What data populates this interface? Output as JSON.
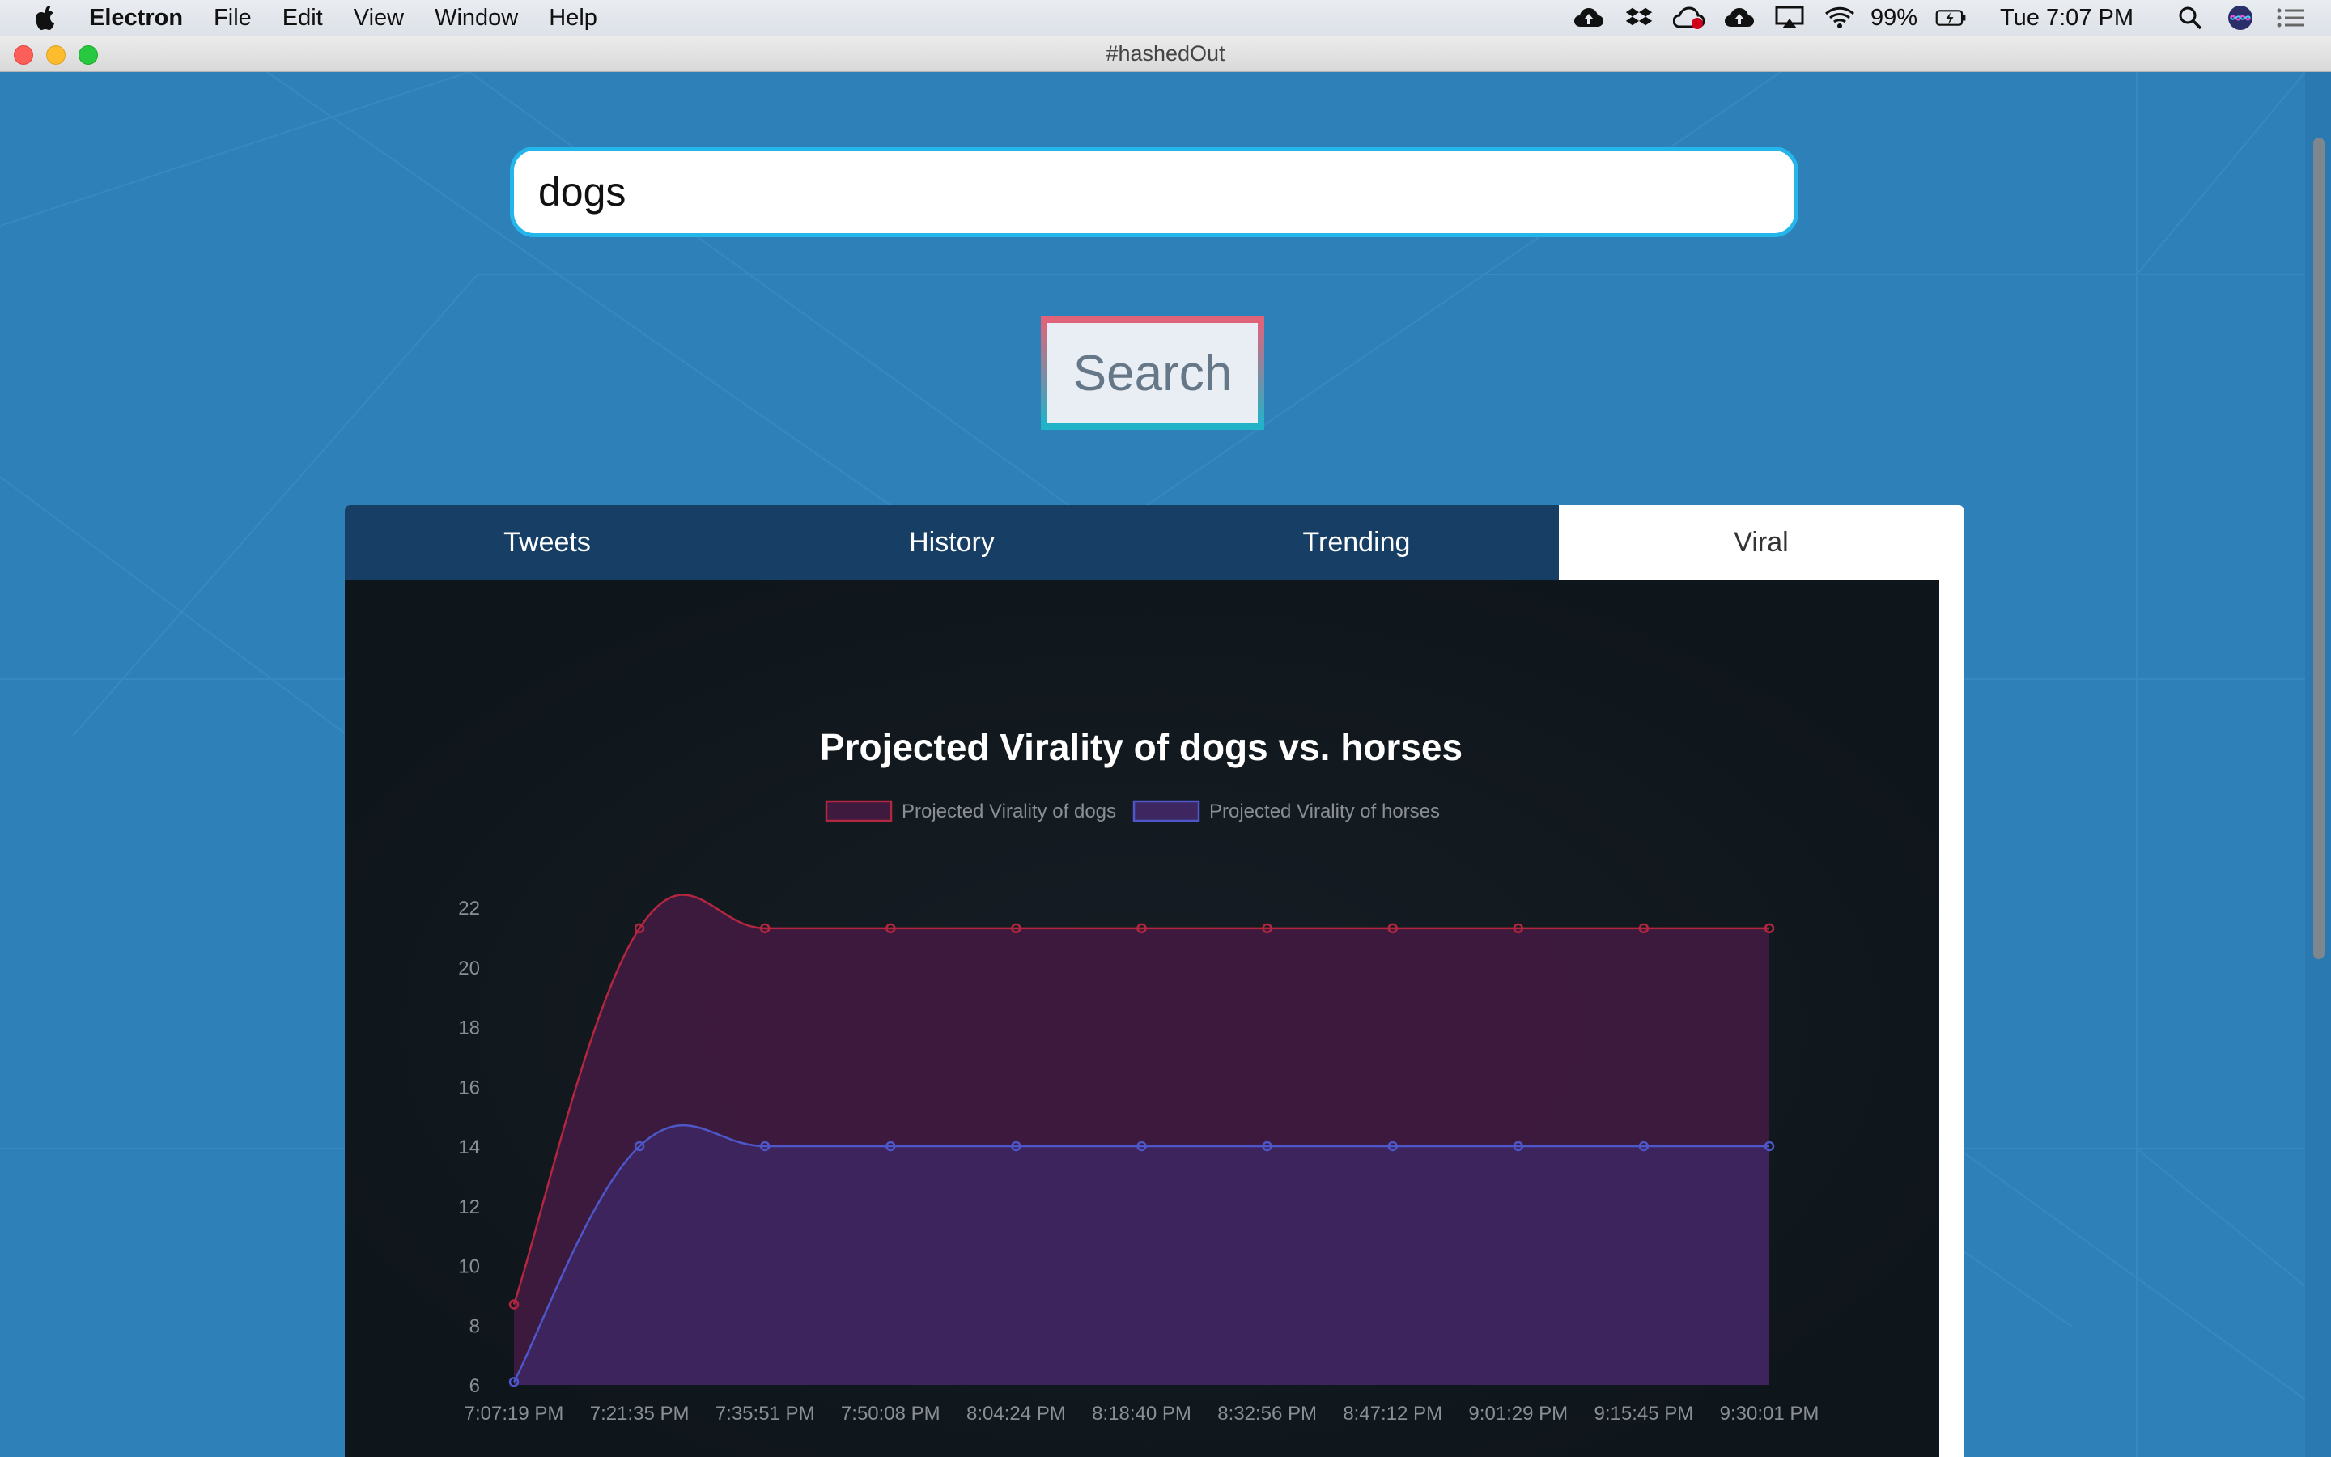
{
  "menubar": {
    "app_name": "Electron",
    "items": [
      "File",
      "Edit",
      "View",
      "Window",
      "Help"
    ],
    "battery": "99%",
    "clock": "Tue 7:07 PM",
    "icons": [
      "apple-icon",
      "cloud-upload-icon",
      "dropbox-icon",
      "creative-cloud-icon",
      "cloud-upload-icon",
      "airplay-icon",
      "wifi-icon",
      "battery-icon",
      "search-icon",
      "siri-icon",
      "notification-center-icon"
    ]
  },
  "window": {
    "title": "#hashedOut"
  },
  "search": {
    "value": "dogs",
    "button_label": "Search"
  },
  "tabs": [
    {
      "label": "Tweets",
      "active": false
    },
    {
      "label": "History",
      "active": false
    },
    {
      "label": "Trending",
      "active": false
    },
    {
      "label": "Viral",
      "active": true
    }
  ],
  "colors": {
    "dogs_line": "#b3263f",
    "dogs_fill": "#3f1a3f",
    "horses_line": "#4d57c9",
    "horses_fill": "#3e2660",
    "tab_bg": "#173f66",
    "accent": "#24b6ea"
  },
  "chart_data": {
    "type": "area",
    "title": "Projected Virality of dogs vs. horses",
    "x": [
      "7:07:19 PM",
      "7:21:35 PM",
      "7:35:51 PM",
      "7:50:08 PM",
      "8:04:24 PM",
      "8:18:40 PM",
      "8:32:56 PM",
      "8:47:12 PM",
      "9:01:29 PM",
      "9:15:45 PM",
      "9:30:01 PM"
    ],
    "series": [
      {
        "name": "Projected Virality of dogs",
        "values": [
          8.7,
          21.3,
          21.3,
          21.3,
          21.3,
          21.3,
          21.3,
          21.3,
          21.3,
          21.3,
          21.3
        ]
      },
      {
        "name": "Projected Virality of horses",
        "values": [
          6.1,
          14,
          14,
          14,
          14,
          14,
          14,
          14,
          14,
          14,
          14
        ]
      }
    ],
    "ylim": [
      6,
      22
    ],
    "yticks": [
      6,
      8,
      10,
      12,
      14,
      16,
      18,
      20,
      22
    ],
    "legend": "top-center",
    "grid": false
  }
}
